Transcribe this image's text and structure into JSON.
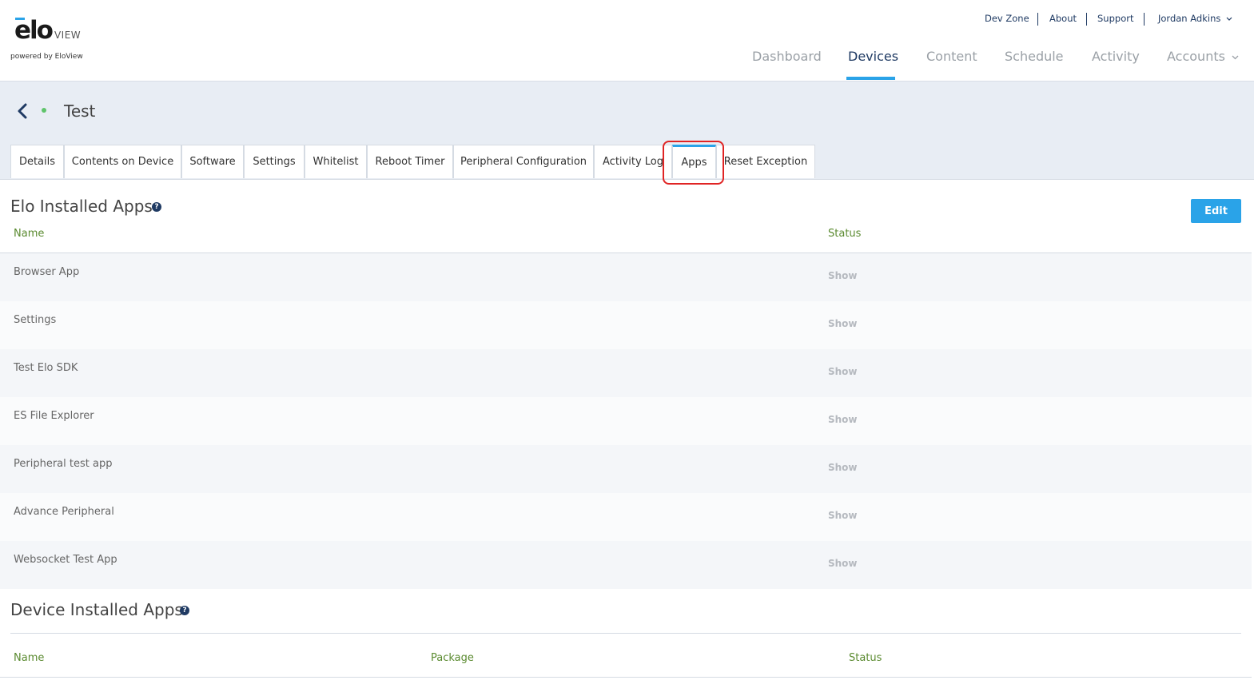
{
  "logo": {
    "brand": "elo",
    "product": "VIEW",
    "powered_by": "powered by EloView"
  },
  "utility_nav": {
    "dev_zone": "Dev Zone",
    "about": "About",
    "support": "Support",
    "user": "Jordan Adkins"
  },
  "main_nav": {
    "items": [
      "Dashboard",
      "Devices",
      "Content",
      "Schedule",
      "Activity",
      "Accounts"
    ],
    "active": "Devices"
  },
  "device": {
    "name": "Test",
    "status_color": "#5fc46b"
  },
  "tabs": {
    "items": [
      "Details",
      "Contents on Device",
      "Software",
      "Settings",
      "Whitelist",
      "Reboot Timer",
      "Peripheral Configuration",
      "Activity Log",
      "Apps",
      "Reset Exception"
    ],
    "active": "Apps"
  },
  "elo_apps": {
    "title": "Elo Installed Apps",
    "edit_label": "Edit",
    "columns": {
      "name": "Name",
      "status": "Status"
    },
    "rows": [
      {
        "name": "Browser App",
        "status": "Show"
      },
      {
        "name": "Settings",
        "status": "Show"
      },
      {
        "name": "Test Elo SDK",
        "status": "Show"
      },
      {
        "name": "ES File Explorer",
        "status": "Show"
      },
      {
        "name": "Peripheral test app",
        "status": "Show"
      },
      {
        "name": "Advance Peripheral",
        "status": "Show"
      },
      {
        "name": "Websocket Test App",
        "status": "Show"
      }
    ]
  },
  "device_apps": {
    "title": "Device Installed Apps",
    "columns": {
      "name": "Name",
      "package": "Package",
      "status": "Status"
    }
  },
  "colors": {
    "accent": "#2aa3e8",
    "nav_active": "#1f3a63",
    "column_header": "#5a8a2f",
    "highlight": "#e02424"
  }
}
